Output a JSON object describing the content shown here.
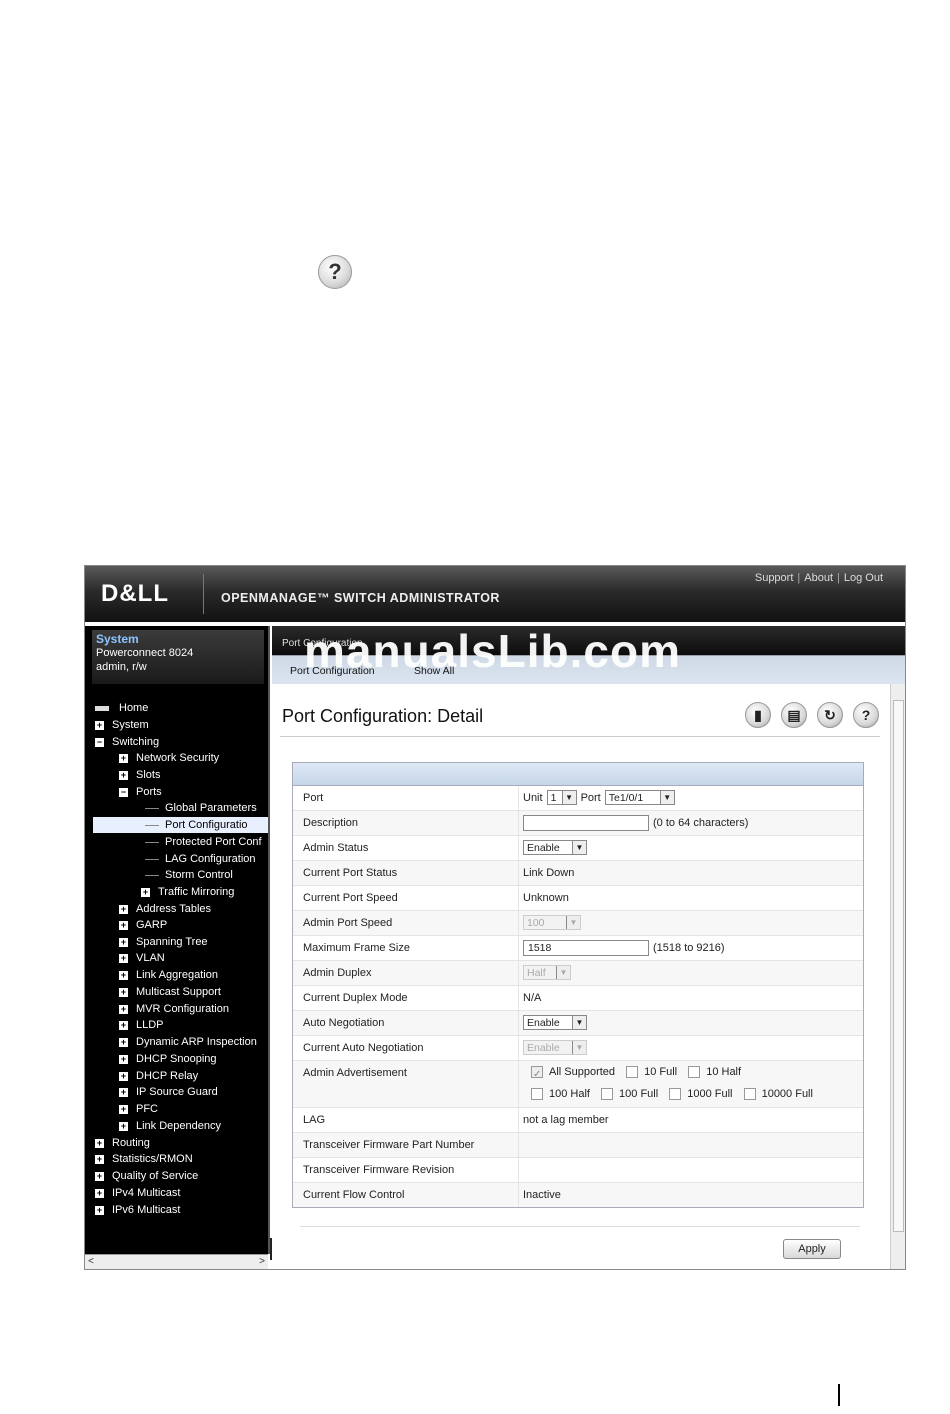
{
  "header": {
    "brand": "D&LL",
    "product": "OPENMANAGE™ SWITCH ADMINISTRATOR",
    "links": [
      "Support",
      "About",
      "Log Out"
    ]
  },
  "system": {
    "title": "System",
    "model": "Powerconnect 8024",
    "user": "admin, r/w"
  },
  "nav": {
    "home": "Home",
    "system": "System",
    "switching": "Switching",
    "network_security": "Network Security",
    "slots": "Slots",
    "ports": "Ports",
    "global_parameters": "Global Parameters",
    "port_configuration": "Port Configuratio",
    "protected_port": "Protected Port Conf",
    "lag_configuration": "LAG Configuration",
    "storm_control": "Storm Control",
    "traffic_mirroring": "Traffic Mirroring",
    "address_tables": "Address Tables",
    "garp": "GARP",
    "spanning_tree": "Spanning Tree",
    "vlan": "VLAN",
    "link_aggregation": "Link Aggregation",
    "multicast_support": "Multicast Support",
    "mvr_configuration": "MVR Configuration",
    "lldp": "LLDP",
    "dynamic_arp": "Dynamic ARP Inspection",
    "dhcp_snooping": "DHCP Snooping",
    "dhcp_relay": "DHCP Relay",
    "ip_source_guard": "IP Source Guard",
    "pfc": "PFC",
    "link_dependency": "Link Dependency",
    "routing": "Routing",
    "statistics_rmon": "Statistics/RMON",
    "qos": "Quality of Service",
    "ipv4_multicast": "IPv4 Multicast",
    "ipv6_multicast": "IPv6 Multicast"
  },
  "tabs": {
    "title": "Port Configuration",
    "watermark": "manualsLib.com",
    "sub1": "Port Configuration",
    "sub2": "Show All"
  },
  "page": {
    "title": "Port Configuration: Detail",
    "apply": "Apply"
  },
  "fields": {
    "port_label": "Port",
    "unit_label": "Unit",
    "unit_value": "1",
    "port_word": "Port",
    "port_value": "Te1/0/1",
    "description_label": "Description",
    "description_value": "",
    "description_hint": "(0 to 64 characters)",
    "admin_status_label": "Admin Status",
    "admin_status_value": "Enable",
    "current_port_status_label": "Current Port Status",
    "current_port_status_value": "Link Down",
    "current_port_speed_label": "Current Port Speed",
    "current_port_speed_value": "Unknown",
    "admin_port_speed_label": "Admin Port Speed",
    "admin_port_speed_value": "100",
    "max_frame_label": "Maximum Frame Size",
    "max_frame_value": "1518",
    "max_frame_hint": "(1518 to 9216)",
    "admin_duplex_label": "Admin Duplex",
    "admin_duplex_value": "Half",
    "current_duplex_label": "Current Duplex Mode",
    "current_duplex_value": "N/A",
    "auto_neg_label": "Auto Negotiation",
    "auto_neg_value": "Enable",
    "current_auto_neg_label": "Current Auto Negotiation",
    "current_auto_neg_value": "Enable",
    "admin_adv_label": "Admin Advertisement",
    "adv_all": "All Supported",
    "adv_10full": "10 Full",
    "adv_10half": "10 Half",
    "adv_100half": "100 Half",
    "adv_100full": "100 Full",
    "adv_1000full": "1000 Full",
    "adv_10000full": "10000 Full",
    "lag_label": "LAG",
    "lag_value": "not a lag member",
    "fw_part_label": "Transceiver Firmware Part Number",
    "fw_part_value": "",
    "fw_rev_label": "Transceiver Firmware Revision",
    "fw_rev_value": "",
    "flow_label": "Current Flow Control",
    "flow_value": "Inactive"
  }
}
